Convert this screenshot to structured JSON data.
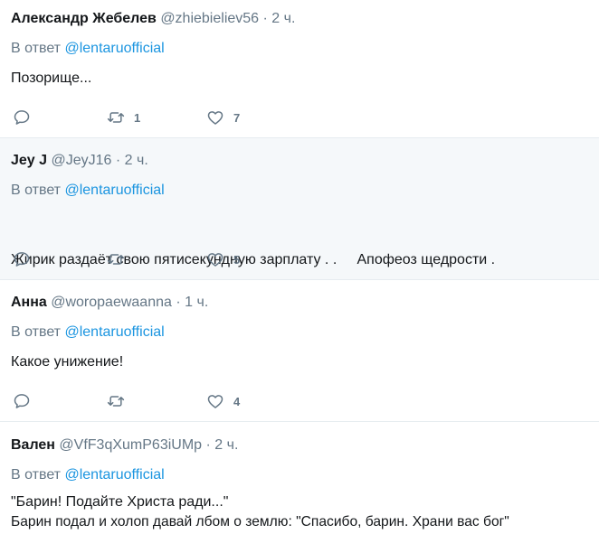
{
  "tweets": [
    {
      "name": "Александр Жебелев",
      "handle": "@zhiebieliev56",
      "time": "2 ч.",
      "reply_prefix": "В ответ",
      "reply_to": "@lentaruofficial",
      "text_lines": [
        "Позорище..."
      ],
      "retweets": "1",
      "likes": "7"
    },
    {
      "name": "Jey J",
      "handle": "@JeyJ16",
      "time": "2 ч.",
      "reply_prefix": "В ответ",
      "reply_to": "@lentaruofficial",
      "text_lines": [
        "Жирик раздаёт свою пятисекундную зарплату . .     Апофеоз щедрости ."
      ],
      "retweets": "",
      "likes": "5"
    },
    {
      "name": "Анна",
      "handle": "@woropaewaanna",
      "time": "1 ч.",
      "reply_prefix": "В ответ",
      "reply_to": "@lentaruofficial",
      "text_lines": [
        "Какое унижение!"
      ],
      "retweets": "",
      "likes": "4"
    },
    {
      "name": "Вален",
      "handle": "@VfF3qXumP63iUMp",
      "time": "2 ч.",
      "reply_prefix": "В ответ",
      "reply_to": "@lentaruofficial",
      "text_lines": [
        "\"Барин! Подайте Христа ради...\"",
        "Барин подал и холоп давай лбом о землю: \"Спасибо, барин. Храни вас бог\""
      ],
      "retweets": "",
      "likes": ""
    }
  ],
  "separator": "·",
  "colors": {
    "link": "#1b95e0",
    "secondary": "#657786",
    "text": "#14171a",
    "highlight_bg": "#f5f8fa",
    "border": "#e6ecf0"
  },
  "icons": {
    "reply": "reply-icon",
    "retweet": "retweet-icon",
    "like": "heart-icon"
  }
}
